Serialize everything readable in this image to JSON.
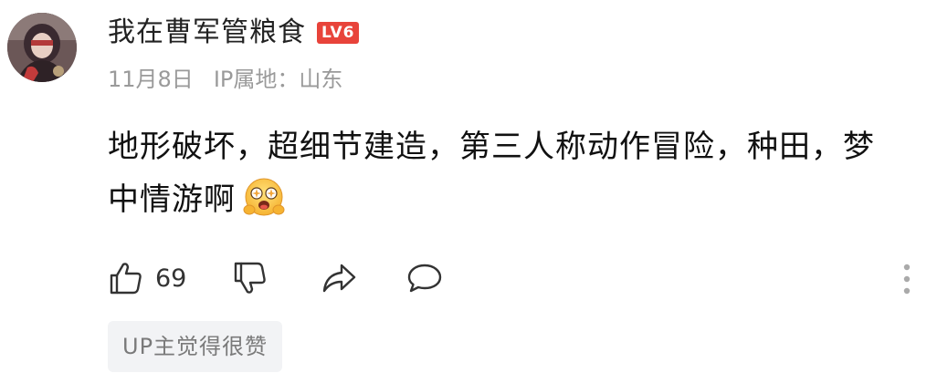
{
  "user": {
    "name": "我在曹军管粮食",
    "level": "LV6",
    "level_color": "#e8433a"
  },
  "meta": {
    "date": "11月8日",
    "ip_location": "IP属地：山东"
  },
  "comment": {
    "text": "地形破坏，超细节建造，第三人称动作冒险，种田，梦中情游啊",
    "emoji": "starry-eyed-face-emoji"
  },
  "actions": {
    "like_icon": "thumbs-up-icon",
    "like_count": "69",
    "dislike_icon": "thumbs-down-icon",
    "share_icon": "share-icon",
    "reply_icon": "comment-icon",
    "more_icon": "more-vertical-icon"
  },
  "up_tag": {
    "label": "UP主觉得很赞"
  }
}
